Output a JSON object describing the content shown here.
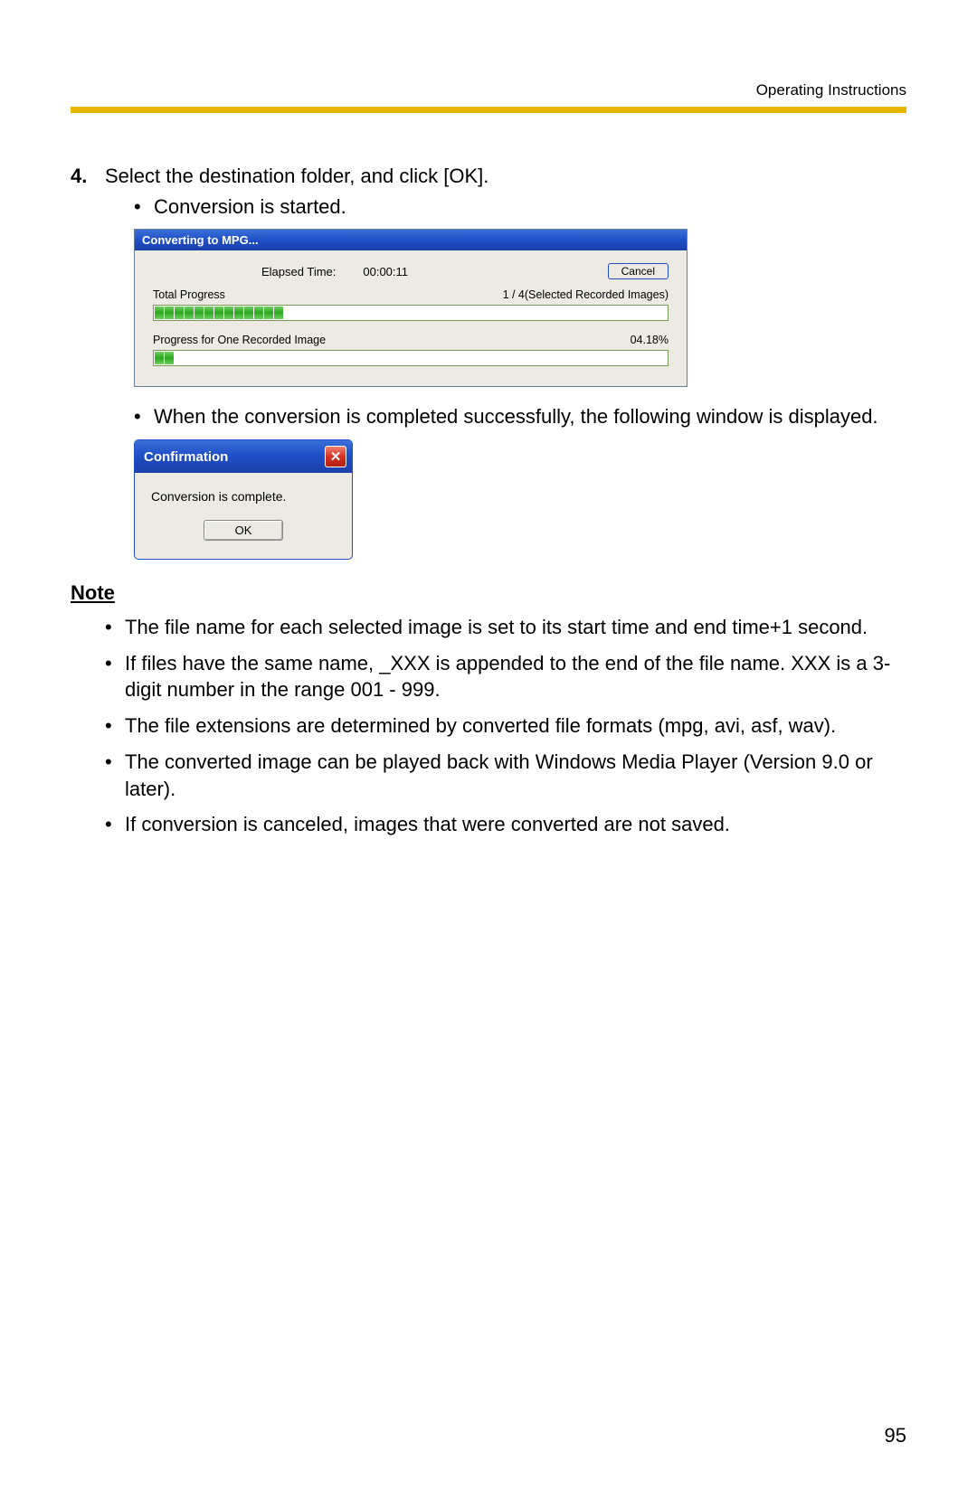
{
  "header": "Operating Instructions",
  "step": {
    "number": "4.",
    "text": "Select the destination folder, and click [OK].",
    "sub1": "Conversion is started.",
    "sub2": "When the conversion is completed successfully, the following window is displayed."
  },
  "progress_dialog": {
    "title": "Converting to MPG...",
    "elapsed_label": "Elapsed Time:",
    "elapsed_value": "00:00:11",
    "cancel": "Cancel",
    "total_label": "Total Progress",
    "total_count": "1 / 4(Selected Recorded Images)",
    "one_label": "Progress for One Recorded Image",
    "one_percent": "04.18%"
  },
  "confirm_dialog": {
    "title": "Confirmation",
    "message": "Conversion is complete.",
    "ok": "OK"
  },
  "note": {
    "heading": "Note",
    "items": [
      "The file name for each selected image is set to its start time and end time+1 second.",
      "If files have the same name, _XXX is appended to the end of the file name. XXX is a 3-digit number in the range 001 - 999.",
      "The file extensions are determined by converted file formats (mpg, avi, asf, wav).",
      "The converted image can be played back with Windows Media Player (Version 9.0 or later).",
      "If conversion is canceled, images that were converted are not saved."
    ]
  },
  "page_number": "95"
}
